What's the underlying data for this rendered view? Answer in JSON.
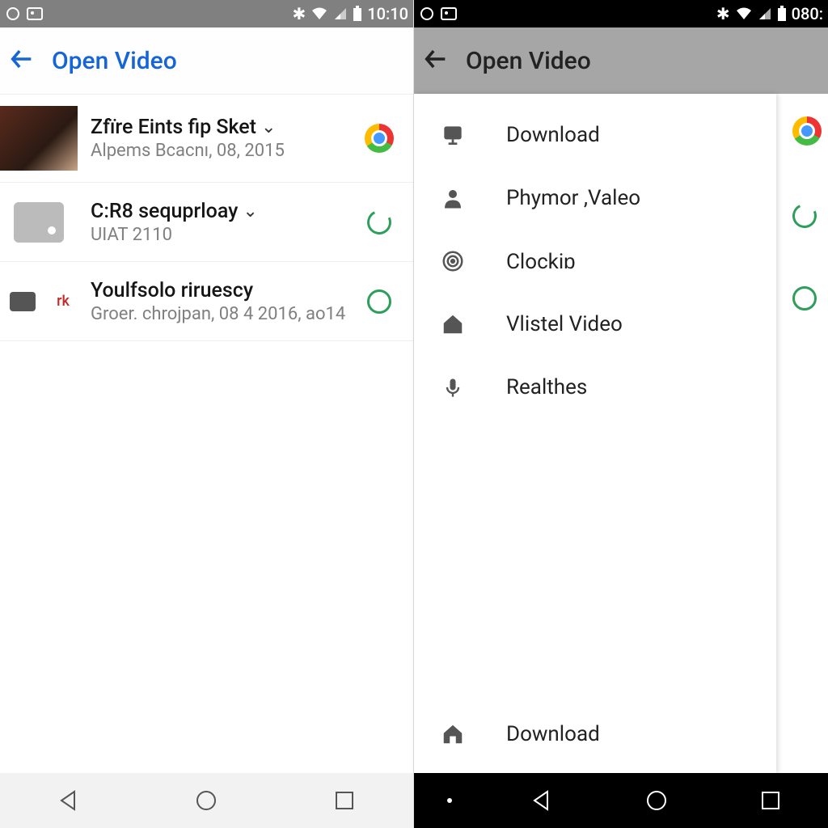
{
  "left": {
    "status": {
      "time": "10:10"
    },
    "appbar": {
      "title": "Open Video"
    },
    "rows": [
      {
        "title": "Zfïre Eints fip Sket",
        "sub": "Alpems Bcacnı, 08, 2015"
      },
      {
        "title": "C:R8 sequprloay",
        "sub": "UIAT 2110"
      },
      {
        "title": "Youlfsolo riruescy",
        "sub": "Groer. chrojpan, 08 4 2016, ao14",
        "rk": "rk"
      }
    ]
  },
  "right": {
    "status": {
      "time": "080:"
    },
    "appbar": {
      "title": "Open Video"
    },
    "drawer": {
      "items": [
        {
          "label": "Download"
        },
        {
          "label": "Phymor ,Valeo"
        },
        {
          "label": "Clockiɒ"
        },
        {
          "label": "Vlistel Video"
        },
        {
          "label": "Realthes"
        }
      ],
      "bottom": {
        "label": "Download"
      }
    }
  }
}
